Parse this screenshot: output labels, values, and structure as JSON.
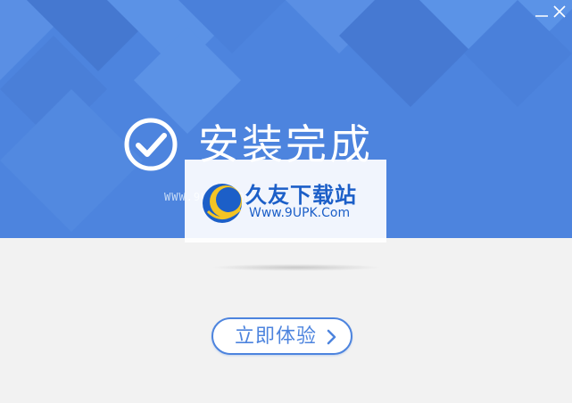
{
  "window": {
    "minimize_icon": "minimize-icon",
    "close_icon": "close-icon"
  },
  "header": {
    "title": "安装完成",
    "check_icon": "check-circle-icon",
    "background_color": "#4d84de"
  },
  "watermark": {
    "faint_url": "WWW.9UPK.COM",
    "site_name": "久友下载站",
    "site_url": "Www.9UPK.Com",
    "logo_icon": "9upk-logo-icon"
  },
  "action": {
    "button_label": "立即体验",
    "arrow_icon": "chevron-right-icon",
    "accent_color": "#4d84de"
  },
  "body": {
    "background_color": "#f2f2f2"
  }
}
